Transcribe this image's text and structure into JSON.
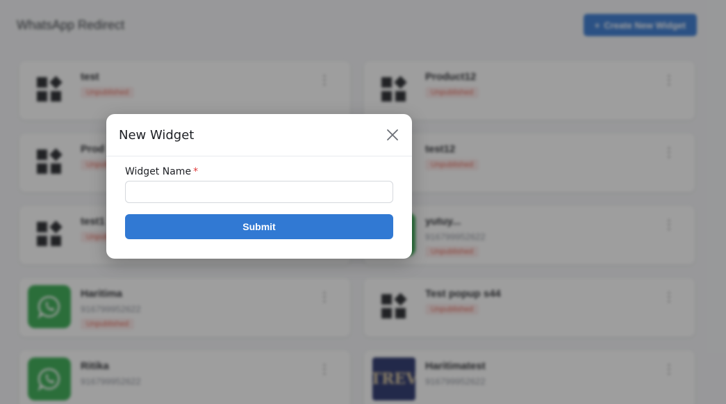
{
  "page": {
    "title": "WhatsApp Redirect",
    "create_button_label": "Create New Widget",
    "create_button_icon": "plus-icon"
  },
  "widgets": [
    {
      "name": "test",
      "phone": "",
      "status": "Unpublished",
      "icon": "widgets-icon"
    },
    {
      "name": "Product12",
      "phone": "",
      "status": "Unpublished",
      "icon": "widgets-icon"
    },
    {
      "name": "Prod",
      "phone": "",
      "status": "Unpublished",
      "icon": "widgets-icon"
    },
    {
      "name": "test12",
      "phone": "",
      "status": "Unpublished",
      "icon": "widgets-icon"
    },
    {
      "name": "test1",
      "phone": "",
      "status": "Unpublished",
      "icon": "widgets-icon"
    },
    {
      "name": "yutuy...",
      "phone": "916799952622",
      "status": "Unpublished",
      "icon": "whatsapp-icon"
    },
    {
      "name": "Haritima",
      "phone": "916799952622",
      "status": "Unpublished",
      "icon": "whatsapp-icon"
    },
    {
      "name": "Test popup s44",
      "phone": "",
      "status": "Unpublished",
      "icon": "widgets-icon"
    },
    {
      "name": "Ritika",
      "phone": "916799952622",
      "status": "",
      "icon": "whatsapp-icon"
    },
    {
      "name": "Haritimatest",
      "phone": "916799952622",
      "status": "",
      "icon": "image-thumbnail",
      "image_text": "TREV"
    }
  ],
  "modal": {
    "title": "New Widget",
    "close_icon": "close-icon",
    "field_label": "Widget Name",
    "required_mark": "*",
    "input_value": "",
    "input_placeholder": "",
    "submit_label": "Submit"
  },
  "colors": {
    "primary": "#3179d3",
    "whatsapp_green": "#2ea84a",
    "unpublished_text": "#e05d4b",
    "required": "#e03a3a"
  }
}
